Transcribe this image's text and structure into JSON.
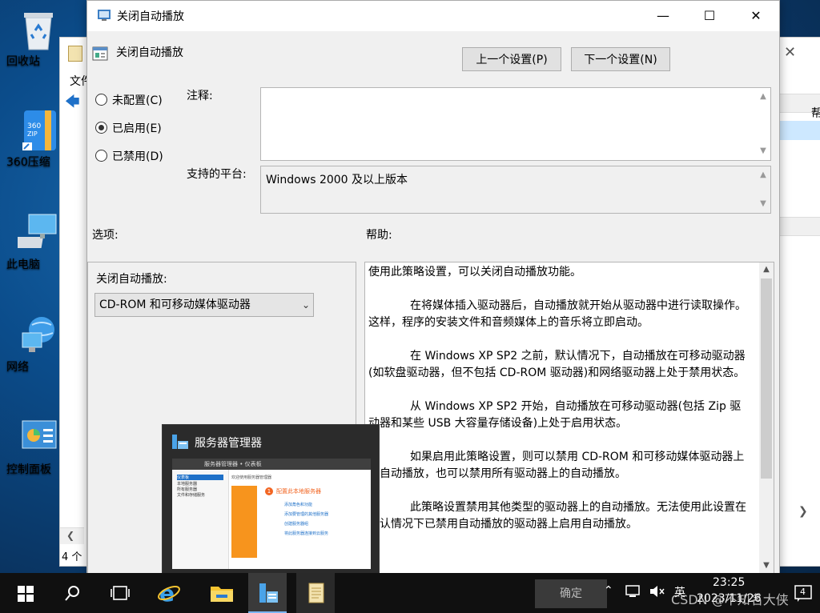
{
  "desktop": {
    "icons": [
      {
        "label": "回收站",
        "icon": "recycle-bin-icon"
      },
      {
        "label": "360压缩",
        "icon": "zip-archive-icon"
      },
      {
        "label": "此电脑",
        "icon": "computer-icon"
      },
      {
        "label": "网络",
        "icon": "network-icon"
      },
      {
        "label": "控制面板",
        "icon": "control-panel-icon"
      }
    ]
  },
  "background_window": {
    "menu_label": "文件",
    "status": "4 个",
    "right_text": "帮"
  },
  "dialog": {
    "title": "关闭自动播放",
    "header": "关闭自动播放",
    "prev_button": "上一个设置(P)",
    "next_button": "下一个设置(N)",
    "radios": [
      {
        "label": "未配置(C)",
        "checked": false
      },
      {
        "label": "已启用(E)",
        "checked": true
      },
      {
        "label": "已禁用(D)",
        "checked": false
      }
    ],
    "comment_label": "注释:",
    "comment_value": "",
    "platform_label": "支持的平台:",
    "platform_value": "Windows 2000 及以上版本",
    "options_label": "选项:",
    "help_label": "帮助:",
    "option_field_label": "关闭自动播放:",
    "option_selected": "CD-ROM 和可移动媒体驱动器",
    "help_paragraphs": [
      "使用此策略设置，可以关闭自动播放功能。",
      "在将媒体插入驱动器后，自动播放就开始从驱动器中进行读取操作。这样，程序的安装文件和音频媒体上的音乐将立即启动。",
      "在 Windows XP SP2 之前，默认情况下，自动播放在可移动驱动器(如软盘驱动器，但不包括 CD-ROM 驱动器)和网络驱动器上处于禁用状态。",
      "从 Windows XP SP2 开始，自动播放在可移动驱动器(包括 Zip 驱动器和某些 USB 大容量存储设备)上处于启用状态。",
      "如果启用此策略设置，则可以禁用 CD-ROM 和可移动媒体驱动器上的自动播放，也可以禁用所有驱动器上的自动播放。",
      "此策略设置禁用其他类型的驱动器上的自动播放。无法使用此设置在默认情况下已禁用自动播放的驱动器上启用自动播放。"
    ]
  },
  "preview": {
    "title": "服务器管理器",
    "breadcrumb": "服务器管理器 • 仪表板",
    "sidebar": [
      "仪表板",
      "本地服务器",
      "所有服务器",
      "文件和存储服务"
    ],
    "top_note": "欢迎使用服务器管理器",
    "welcome_num": "1",
    "welcome_text": "配置此本地服务器",
    "links": [
      "添加角色和功能",
      "添加要管理的其他服务器",
      "创建服务器组",
      "将此服务器连接到云服务"
    ]
  },
  "taskbar": {
    "confirm_label": "确定",
    "ime": "英",
    "time": "23:25",
    "date": "2023/11/26",
    "watermark": "CSDN @不知名大侠",
    "notification_count": "4"
  },
  "colors": {
    "accent": "#1e70c8",
    "taskbar": "#101010",
    "dialog_bg": "#f0f0f0"
  }
}
